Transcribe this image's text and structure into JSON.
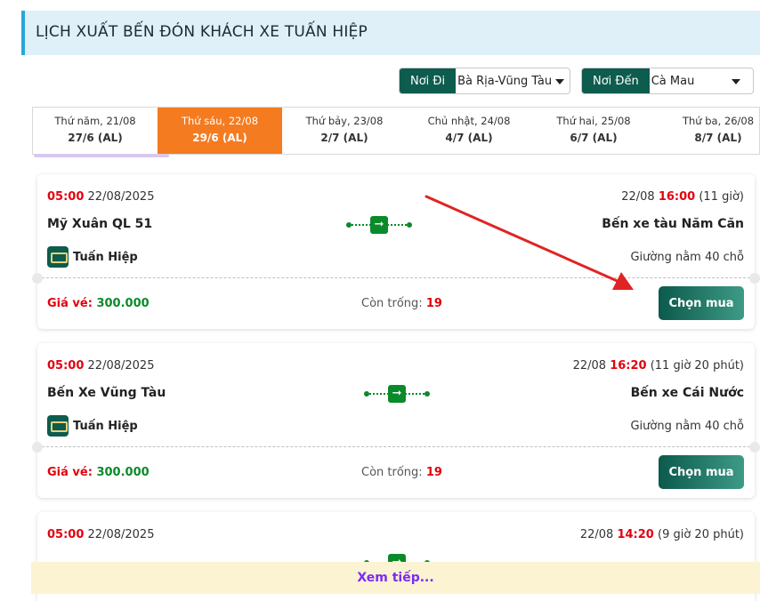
{
  "header": {
    "title": "LỊCH XUẤT BẾN ĐÓN KHÁCH XE TUẤN HIỆP"
  },
  "filters": {
    "from": {
      "label": "Nơi Đi",
      "value": "Bà Rịa-Vũng Tàu"
    },
    "to": {
      "label": "Nơi Đến",
      "value": "Cà Mau"
    }
  },
  "dates": [
    {
      "day": "Thứ năm, 21/08",
      "lunar": "27/6 (AL)",
      "active": false
    },
    {
      "day": "Thứ sáu, 22/08",
      "lunar": "29/6 (AL)",
      "active": true
    },
    {
      "day": "Thứ bảy, 23/08",
      "lunar": "2/7 (AL)",
      "active": false
    },
    {
      "day": "Chủ nhật, 24/08",
      "lunar": "4/7 (AL)",
      "active": false
    },
    {
      "day": "Thứ hai, 25/08",
      "lunar": "6/7 (AL)",
      "active": false
    },
    {
      "day": "Thứ ba, 26/08",
      "lunar": "8/7 (AL)",
      "active": false
    }
  ],
  "trips": [
    {
      "depart_time": "05:00",
      "depart_date": "22/08/2025",
      "arrive_date": "22/08",
      "arrive_time": "16:00",
      "duration": "(11 giờ)",
      "from": "Mỹ Xuân QL 51",
      "to": "Bến xe tàu Năm Căn",
      "operator": "Tuấn Hiệp",
      "seat_type": "Giường nằm 40 chỗ",
      "price_label": "Giá vé:",
      "price": "300.000",
      "seats_label": "Còn trống:",
      "seats": "19",
      "buy_label": "Chọn mua"
    },
    {
      "depart_time": "05:00",
      "depart_date": "22/08/2025",
      "arrive_date": "22/08",
      "arrive_time": "16:20",
      "duration": "(11 giờ 20 phút)",
      "from": "Bến Xe Vũng Tàu",
      "to": "Bến xe Cái Nước",
      "operator": "Tuấn Hiệp",
      "seat_type": "Giường nằm 40 chỗ",
      "price_label": "Giá vé:",
      "price": "300.000",
      "seats_label": "Còn trống:",
      "seats": "19",
      "buy_label": "Chọn mua"
    },
    {
      "depart_time": "05:00",
      "depart_date": "22/08/2025",
      "arrive_date": "22/08",
      "arrive_time": "14:20",
      "duration": "(9 giờ 20 phút)"
    }
  ],
  "more": {
    "label": "Xem tiếp..."
  },
  "colors": {
    "accent": "#0d5c4e",
    "active_tab": "#f47b20",
    "time_red": "#e3000f",
    "price_green": "#0a8a2a",
    "more_text": "#7b2cf0",
    "annotation_arrow": "#e02424"
  }
}
